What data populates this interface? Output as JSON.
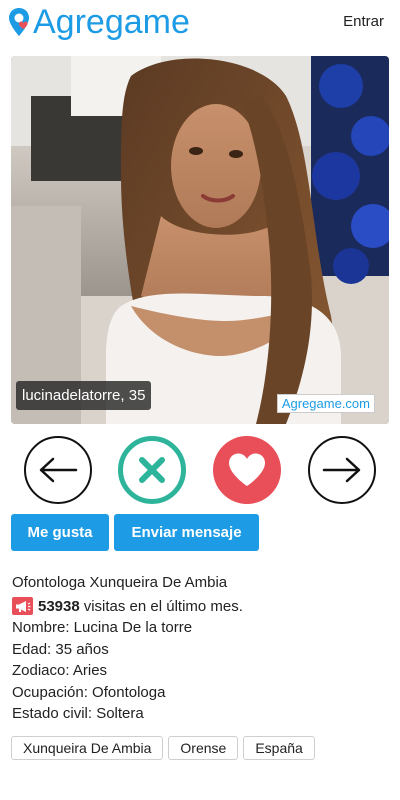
{
  "header": {
    "brand": "Agregame",
    "login_label": "Entrar"
  },
  "photo": {
    "name_age": "lucinadelatorre, 35",
    "watermark": "Agregame.com"
  },
  "actions": {
    "prev": "arrow-left-icon",
    "reject": "x-icon",
    "like": "heart-icon",
    "next": "arrow-right-icon"
  },
  "buttons": {
    "like_label": "Me gusta",
    "message_label": "Enviar mensaje"
  },
  "profile": {
    "headline": "Ofontologa Xunqueira De Ambia",
    "visits_count": "53938",
    "visits_text": "visitas en el último mes.",
    "name": "Nombre: Lucina De la torre",
    "age": "Edad: 35 años",
    "zodiac": "Zodiaco: Aries",
    "occupation": "Ocupación: Ofontologa",
    "civil_status": "Estado civil: Soltera"
  },
  "tags": [
    "Xunqueira De Ambia",
    "Orense",
    "España"
  ],
  "colors": {
    "brand_blue": "#1d9be5",
    "reject_green": "#2fb49c",
    "like_red": "#e94f58"
  }
}
